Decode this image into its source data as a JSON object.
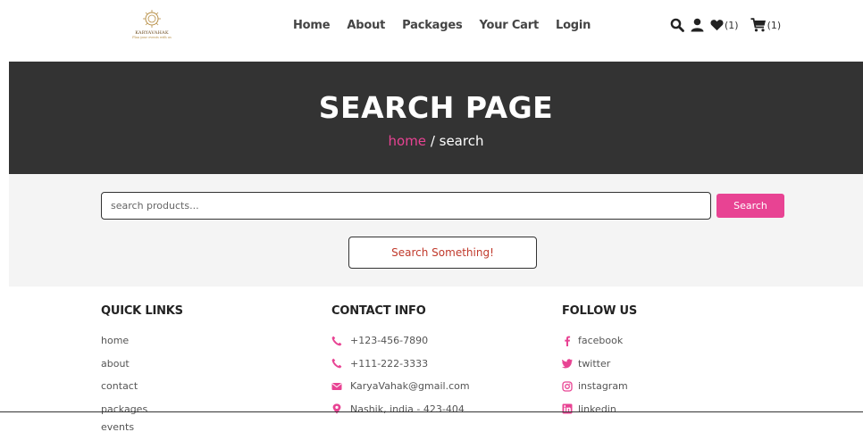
{
  "brand": {
    "logo_text": "KARYAVAHAK",
    "logo_tagline": "Plan your events with us"
  },
  "nav": {
    "items": [
      "Home",
      "About",
      "Packages",
      "Your Cart",
      "Login"
    ]
  },
  "header_icons": {
    "search": "search-icon",
    "user": "user-icon",
    "wishlist": "heart-icon",
    "cart": "cart-icon",
    "wishlist_count": "(1)",
    "cart_count": "(1)"
  },
  "hero": {
    "title": "SEARCH PAGE",
    "breadcrumb_home": "home",
    "breadcrumb_separator": " / ",
    "breadcrumb_current": "search"
  },
  "search": {
    "placeholder": "search products...",
    "button_label": "Search",
    "empty_message": "Search Something!"
  },
  "footer": {
    "quick_links": {
      "title": "QUICK LINKS",
      "items": [
        "home",
        "about",
        "contact",
        "packages",
        "events"
      ]
    },
    "contact_info": {
      "title": "CONTACT INFO",
      "items": [
        "+123-456-7890",
        "+111-222-3333",
        "KaryaVahak@gmail.com",
        "Nashik, india - 423-404"
      ]
    },
    "follow_us": {
      "title": "FOLLOW US",
      "items": [
        "facebook",
        "twitter",
        "instagram",
        "linkedin"
      ]
    }
  },
  "colors": {
    "accent": "#e84393",
    "hero_bg": "#333333",
    "search_bg": "#f4f4f4",
    "empty_text": "#c0392b"
  }
}
